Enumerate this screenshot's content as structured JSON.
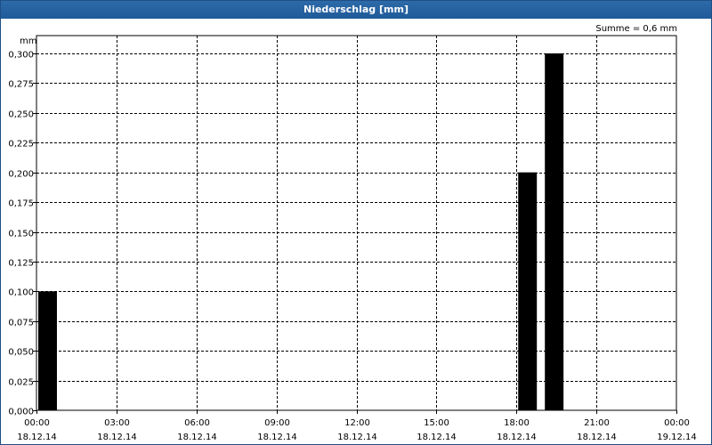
{
  "window": {
    "title": "Niederschlag [mm]"
  },
  "summary": "Summe = 0,6 mm",
  "chart_data": {
    "type": "bar",
    "title": "Niederschlag [mm]",
    "ylabel": "mm",
    "ylim": [
      0,
      0.3
    ],
    "y_ticks": [
      "0,000",
      "0,025",
      "0,050",
      "0,075",
      "0,100",
      "0,125",
      "0,150",
      "0,175",
      "0,200",
      "0,225",
      "0,250",
      "0,275",
      "0,300"
    ],
    "xlim_hours": [
      0,
      24
    ],
    "x_ticks": [
      {
        "time": "00:00",
        "date": "18.12.14"
      },
      {
        "time": "03:00",
        "date": "18.12.14"
      },
      {
        "time": "06:00",
        "date": "18.12.14"
      },
      {
        "time": "09:00",
        "date": "18.12.14"
      },
      {
        "time": "12:00",
        "date": "18.12.14"
      },
      {
        "time": "15:00",
        "date": "18.12.14"
      },
      {
        "time": "18:00",
        "date": "18.12.14"
      },
      {
        "time": "21:00",
        "date": "18.12.14"
      },
      {
        "time": "00:00",
        "date": "19.12.14"
      }
    ],
    "bars": [
      {
        "time": "00:00",
        "value": 0.1
      },
      {
        "time": "18:00",
        "value": 0.2
      },
      {
        "time": "19:00",
        "value": 0.3
      }
    ],
    "grid": true,
    "bar_color": "#000000"
  }
}
